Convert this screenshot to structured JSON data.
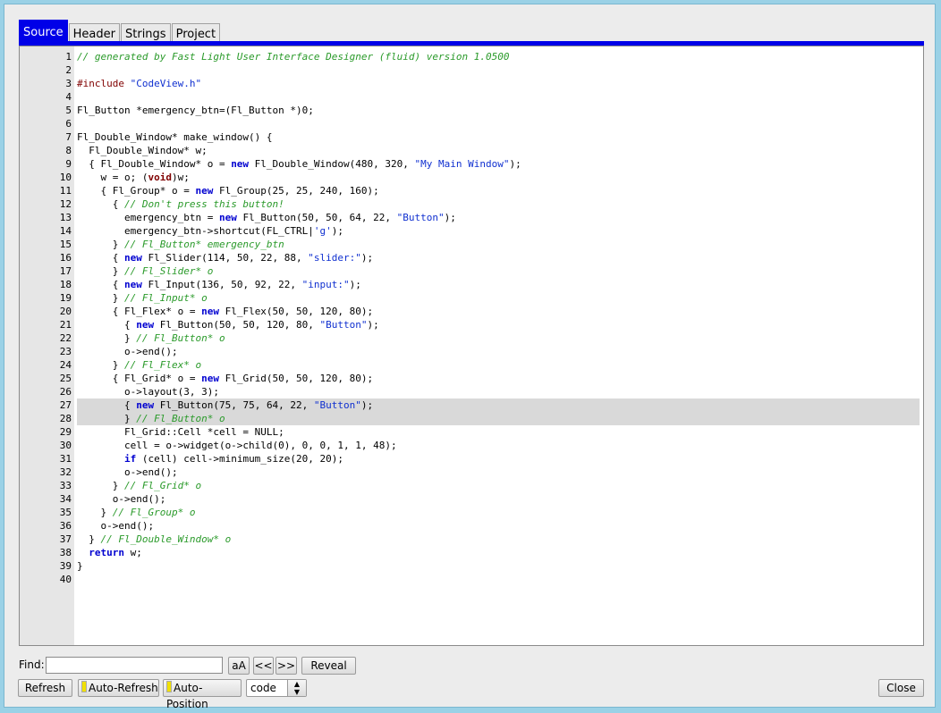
{
  "tabs": [
    "Source",
    "Header",
    "Strings",
    "Project"
  ],
  "active_tab": "Source",
  "code_lines": [
    {
      "n": "1",
      "html": "<span class=\"cm\">// generated by Fast Light User Interface Designer (fluid) version 1.0500</span>"
    },
    {
      "n": "2",
      "html": ""
    },
    {
      "n": "3",
      "html": "<span class=\"pp\">#include</span> <span class=\"str\">\"CodeView.h\"</span>"
    },
    {
      "n": "4",
      "html": ""
    },
    {
      "n": "5",
      "html": "Fl_Button *emergency_btn=(Fl_Button *)0;"
    },
    {
      "n": "6",
      "html": ""
    },
    {
      "n": "7",
      "html": "Fl_Double_Window* make_window() {"
    },
    {
      "n": "8",
      "html": "  Fl_Double_Window* w;"
    },
    {
      "n": "9",
      "html": "  { Fl_Double_Window* o = <span class=\"kw\">new</span> Fl_Double_Window(480, 320, <span class=\"str\">\"My Main Window\"</span>);"
    },
    {
      "n": "10",
      "html": "    w = o; (<span class=\"ty\">void</span>)w;"
    },
    {
      "n": "11",
      "html": "    { Fl_Group* o = <span class=\"kw\">new</span> Fl_Group(25, 25, 240, 160);"
    },
    {
      "n": "12",
      "html": "      { <span class=\"cm\">// Don't press this button!</span>"
    },
    {
      "n": "13",
      "html": "        emergency_btn = <span class=\"kw\">new</span> Fl_Button(50, 50, 64, 22, <span class=\"str\">\"Button\"</span>);"
    },
    {
      "n": "14",
      "html": "        emergency_btn-&gt;shortcut(FL_CTRL|<span class=\"str\">'g'</span>);"
    },
    {
      "n": "15",
      "html": "      } <span class=\"cm\">// Fl_Button* emergency_btn</span>"
    },
    {
      "n": "16",
      "html": "      { <span class=\"kw\">new</span> Fl_Slider(114, 50, 22, 88, <span class=\"str\">\"slider:\"</span>);"
    },
    {
      "n": "17",
      "html": "      } <span class=\"cm\">// Fl_Slider* o</span>"
    },
    {
      "n": "18",
      "html": "      { <span class=\"kw\">new</span> Fl_Input(136, 50, 92, 22, <span class=\"str\">\"input:\"</span>);"
    },
    {
      "n": "19",
      "html": "      } <span class=\"cm\">// Fl_Input* o</span>"
    },
    {
      "n": "20",
      "html": "      { Fl_Flex* o = <span class=\"kw\">new</span> Fl_Flex(50, 50, 120, 80);"
    },
    {
      "n": "21",
      "html": "        { <span class=\"kw\">new</span> Fl_Button(50, 50, 120, 80, <span class=\"str\">\"Button\"</span>);"
    },
    {
      "n": "22",
      "html": "        } <span class=\"cm\">// Fl_Button* o</span>"
    },
    {
      "n": "23",
      "html": "        o-&gt;end();"
    },
    {
      "n": "24",
      "html": "      } <span class=\"cm\">// Fl_Flex* o</span>"
    },
    {
      "n": "25",
      "html": "      { Fl_Grid* o = <span class=\"kw\">new</span> Fl_Grid(50, 50, 120, 80);"
    },
    {
      "n": "26",
      "html": "        o-&gt;layout(3, 3);"
    },
    {
      "n": "27",
      "html": "        { <span class=\"kw\">new</span> Fl_Button(75, 75, 64, 22, <span class=\"str\">\"Button\"</span>);",
      "hl": true
    },
    {
      "n": "28",
      "html": "        } <span class=\"cm\">// Fl_Button* o</span>",
      "hl": true
    },
    {
      "n": "29",
      "html": "        Fl_Grid::Cell *cell = NULL;"
    },
    {
      "n": "30",
      "html": "        cell = o-&gt;widget(o-&gt;child(0), 0, 0, 1, 1, 48);"
    },
    {
      "n": "31",
      "html": "        <span class=\"kw\">if</span> (cell) cell-&gt;minimum_size(20, 20);"
    },
    {
      "n": "32",
      "html": "        o-&gt;end();"
    },
    {
      "n": "33",
      "html": "      } <span class=\"cm\">// Fl_Grid* o</span>"
    },
    {
      "n": "34",
      "html": "      o-&gt;end();"
    },
    {
      "n": "35",
      "html": "    } <span class=\"cm\">// Fl_Group* o</span>"
    },
    {
      "n": "36",
      "html": "    o-&gt;end();"
    },
    {
      "n": "37",
      "html": "  } <span class=\"cm\">// Fl_Double_Window* o</span>"
    },
    {
      "n": "38",
      "html": "  <span class=\"kw\">return</span> w;"
    },
    {
      "n": "39",
      "html": "}"
    },
    {
      "n": "40",
      "html": ""
    }
  ],
  "find": {
    "label": "Find:",
    "value": "",
    "case_btn": "aA",
    "prev_btn": "<<",
    "next_btn": ">>",
    "reveal_btn": "Reveal"
  },
  "bottom": {
    "refresh": "Refresh",
    "auto_refresh": "Auto-Refresh",
    "auto_position": "Auto-Position",
    "mode_value": "code",
    "close": "Close"
  },
  "colors": {
    "active_tab": "#0000e8",
    "comment": "#2a9a2a",
    "keyword": "#0000d0",
    "string": "#1030d0",
    "highlight": "#d9d9d9"
  }
}
